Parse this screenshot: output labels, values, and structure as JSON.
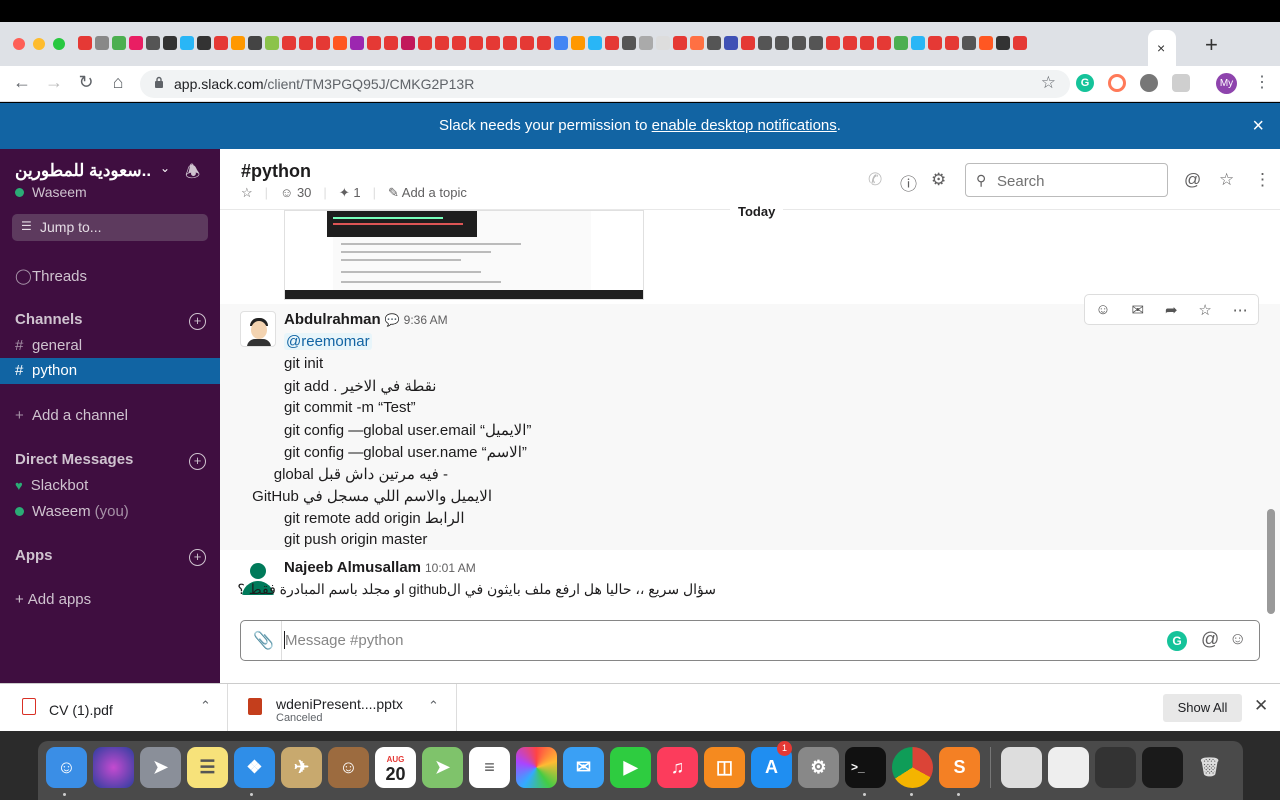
{
  "browser": {
    "url_host": "app.slack.com",
    "url_path": "/client/TM3PGQ95J/CMKG2P13R",
    "profile_initials": "My",
    "close_tab_glyph": "×",
    "new_tab_glyph": "+"
  },
  "banner": {
    "text_before": "Slack needs your permission to ",
    "link_text": "enable desktop notifications",
    "text_after": ".",
    "close_glyph": "×"
  },
  "sidebar": {
    "workspace_name": "..سعودية للمطورين",
    "username": "Waseem",
    "jump_to": "Jump to...",
    "threads": "Threads",
    "channels_heading": "Channels",
    "channels": [
      {
        "name": "general"
      },
      {
        "name": "python"
      }
    ],
    "add_channel": "Add a channel",
    "dm_heading": "Direct Messages",
    "dms": [
      {
        "name": "Slackbot"
      },
      {
        "name": "Waseem",
        "suffix": "(you)"
      }
    ],
    "apps_heading": "Apps",
    "add_apps": "Add apps"
  },
  "channel": {
    "title": "#python",
    "members": "30",
    "pins": "1",
    "add_topic": "Add a topic",
    "search_placeholder": "Search",
    "date_divider": "Today"
  },
  "messages": [
    {
      "sender": "Abdulrahman",
      "time": "9:36 AM",
      "mention": "@reemomar",
      "lines": [
        "git init",
        "git add .  نقطة في الاخير",
        "git commit -m “Test”",
        "git config —global user.email “الايميل”",
        "git config —global user.name “الاسم”",
        "- فيه مرتين داش قبل global",
        "الايميل والاسم اللي مسجل في GitHub",
        "git remote add origin الرابط",
        "git push origin master"
      ]
    },
    {
      "sender": "Najeeb Almusallam",
      "time": "10:01 AM",
      "lines": [
        "سؤال سريع ،، حاليا هل ارفع ملف بايثون في الgithub او مجلد باسم المبادرة فقط ؟"
      ]
    }
  ],
  "composer": {
    "placeholder": "Message #python"
  },
  "downloads": [
    {
      "name": "CV (1).pdf",
      "status": ""
    },
    {
      "name": "wdeniPresent....pptx",
      "status": "Canceled"
    }
  ],
  "downloads_show_all": "Show All",
  "dock": {
    "calendar_month": "AUG",
    "calendar_day": "20",
    "appstore_badge": "1"
  },
  "colors": {
    "sidebar_bg": "#3f0e40",
    "active_channel": "#1164a3",
    "banner_bg": "#1264a3",
    "presence_green": "#2bac76"
  }
}
